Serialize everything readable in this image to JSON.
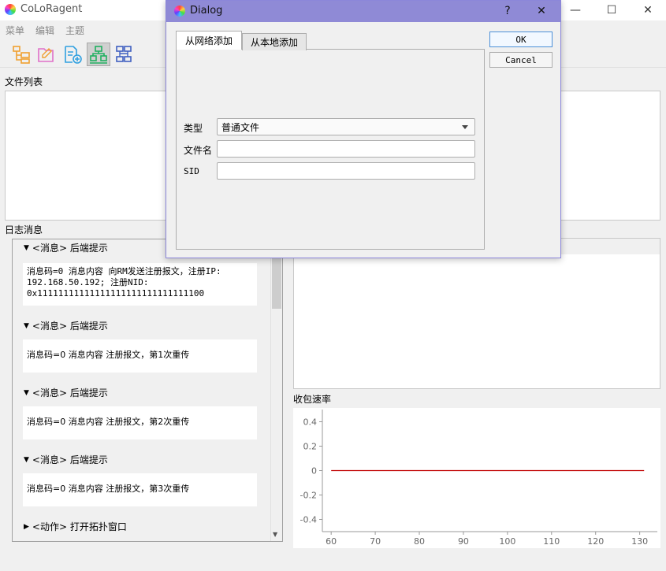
{
  "window": {
    "title": "CoLoRagent",
    "controls": [
      "—",
      "☐",
      "✕"
    ]
  },
  "menubar": {
    "items": [
      "菜单",
      "编辑",
      "主题"
    ]
  },
  "toolbar": {
    "icons": [
      "folder-tree-icon",
      "folder-open-icon",
      "add-file-icon",
      "network-icon",
      "topology-icon"
    ]
  },
  "files": {
    "label": "文件列表"
  },
  "log": {
    "label": "日志消息",
    "partial_header": "<消息> 后端提示",
    "entries": [
      {
        "header": "",
        "body": "消息码=0 消息内容 向RM发送注册报文，注册IP:\n192.168.50.192; 注册NID:\n0x11111111111111111111111111111100"
      },
      {
        "header": "<消息> 后端提示",
        "body": "消息码=0 消息内容 注册报文，第1次重传"
      },
      {
        "header": "<消息> 后端提示",
        "body": "消息码=0 消息内容 注册报文，第2次重传"
      },
      {
        "header": "<消息> 后端提示",
        "body": "消息码=0 消息内容 注册报文，第3次重传"
      }
    ],
    "collapsed_entry": "<动作> 打开拓扑窗口"
  },
  "chart_section": {
    "label": "收包速率"
  },
  "chart_data": {
    "type": "line",
    "title": "收包速率",
    "xlim": [
      58,
      134
    ],
    "ylim": [
      -0.5,
      0.5
    ],
    "xticks": [
      60,
      70,
      80,
      90,
      100,
      110,
      120,
      130
    ],
    "yticks": [
      0.4,
      0.2,
      0,
      -0.2,
      -0.4
    ],
    "series": [
      {
        "color": "#c00000",
        "x": [
          60,
          131
        ],
        "y": [
          0,
          0
        ]
      }
    ],
    "grid": false
  },
  "dialog": {
    "title": "Dialog",
    "help": "?",
    "close": "✕",
    "tabs": [
      "从网络添加",
      "从本地添加"
    ],
    "active_tab": 0,
    "fields": {
      "type_label": "类型",
      "type_value": "普通文件",
      "filename_label": "文件名",
      "filename_value": "",
      "sid_label": "SID",
      "sid_value": ""
    },
    "buttons": {
      "ok": "OK",
      "cancel": "Cancel"
    }
  }
}
